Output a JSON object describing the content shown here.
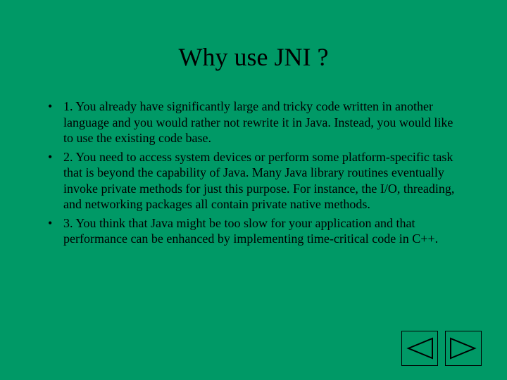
{
  "title": "Why use JNI ?",
  "bullets": {
    "0": "1. You already have significantly large and tricky code written in another language and you would rather not rewrite it in Java. Instead, you would like to use the existing code base.",
    "1": "2. You need to access system devices or perform some platform-specific task that is beyond the capability of Java. Many Java library routines eventually invoke private methods for just this purpose. For instance, the I/O, threading, and networking packages all contain private native methods.",
    "2": "3. You think that Java might be too slow for your application and that performance can be enhanced by implementing time-critical code in C++."
  },
  "colors": {
    "background": "#009966",
    "arrow_fill": "#009966",
    "arrow_stroke": "#000000"
  }
}
